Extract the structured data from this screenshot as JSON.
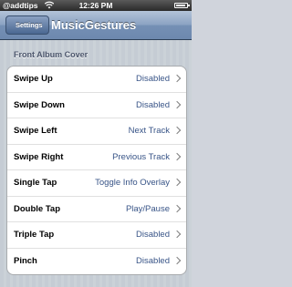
{
  "status_bar": {
    "carrier": "@addtips",
    "time": "12:26 PM",
    "icons": [
      "wifi-icon",
      "battery-icon"
    ]
  },
  "nav": {
    "back_label": "Settings",
    "title": "MusicGestures"
  },
  "section": {
    "header": "Front Album Cover",
    "rows": [
      {
        "label": "Swipe Up",
        "value": "Disabled"
      },
      {
        "label": "Swipe Down",
        "value": "Disabled"
      },
      {
        "label": "Swipe Left",
        "value": "Next Track"
      },
      {
        "label": "Swipe Right",
        "value": "Previous Track"
      },
      {
        "label": "Single Tap",
        "value": "Toggle Info Overlay"
      },
      {
        "label": "Double Tap",
        "value": "Play/Pause"
      },
      {
        "label": "Triple Tap",
        "value": "Disabled"
      },
      {
        "label": "Pinch",
        "value": "Disabled"
      }
    ]
  },
  "colors": {
    "nav_bar": "#8aa2c2",
    "value_text": "#385487",
    "section_header": "#4c566c",
    "background_stripes": "#c5ccd4"
  }
}
